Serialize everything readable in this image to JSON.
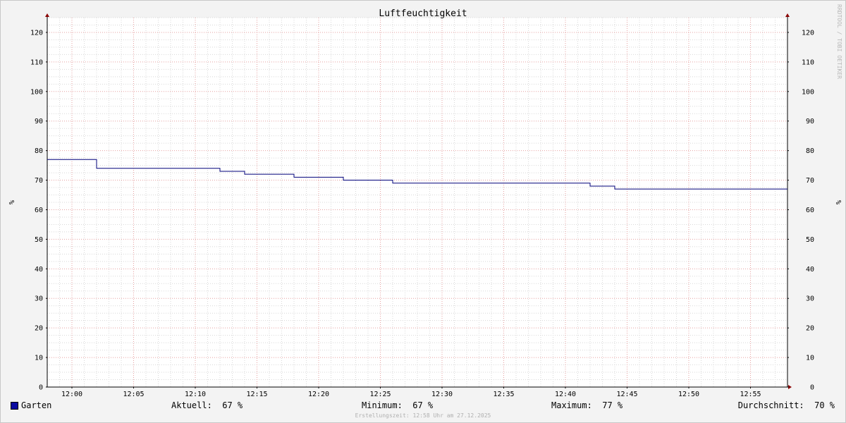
{
  "chart_data": {
    "type": "line",
    "title": "Luftfeuchtigkeit",
    "ylabel": "%",
    "ylabel_right": "%",
    "xlim": [
      "11:58",
      "12:58"
    ],
    "ylim": [
      0,
      125
    ],
    "y_ticks": [
      0,
      10,
      20,
      30,
      40,
      50,
      60,
      70,
      80,
      90,
      100,
      110,
      120
    ],
    "x_ticks": [
      "12:00",
      "12:05",
      "12:10",
      "12:15",
      "12:20",
      "12:25",
      "12:30",
      "12:35",
      "12:40",
      "12:45",
      "12:50",
      "12:55"
    ],
    "grid": true,
    "series": [
      {
        "name": "Garten",
        "color": "#0a0aa0",
        "line_color": "#00007a",
        "step": true,
        "points": [
          {
            "x": "11:58",
            "y": 77
          },
          {
            "x": "12:02",
            "y": 74
          },
          {
            "x": "12:04",
            "y": 74
          },
          {
            "x": "12:12",
            "y": 73
          },
          {
            "x": "12:14",
            "y": 72
          },
          {
            "x": "12:18",
            "y": 71
          },
          {
            "x": "12:22",
            "y": 70
          },
          {
            "x": "12:26",
            "y": 69
          },
          {
            "x": "12:42",
            "y": 68
          },
          {
            "x": "12:44",
            "y": 67
          },
          {
            "x": "12:58",
            "y": 67
          }
        ]
      }
    ]
  },
  "legend": {
    "series_name": "Garten",
    "current": "Aktuell:  67 %",
    "minimum": "Minimum:  67 %",
    "maximum": "Maximum:  77 %",
    "average": "Durchschnitt:  70 %"
  },
  "watermark": "RRDTOOL / TOBI OETIKER",
  "footer": "Erstellungszeit: 12:58 Uhr am 27.12.2025"
}
